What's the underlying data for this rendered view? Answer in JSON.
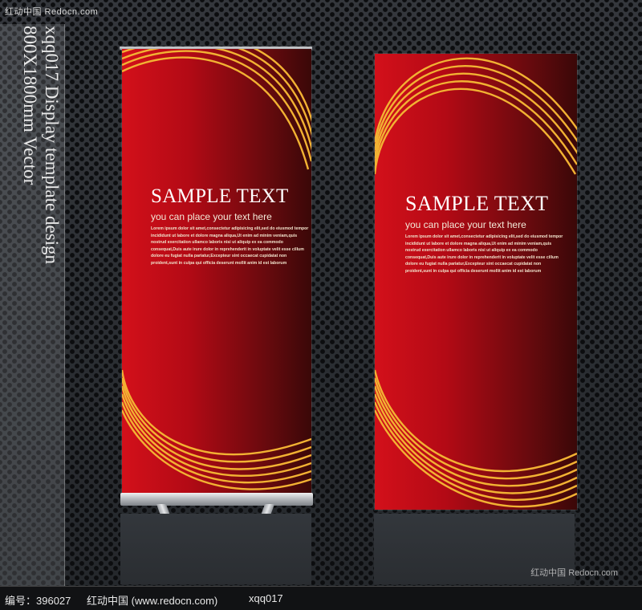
{
  "watermark_top": "红动中国 Redocn.com",
  "watermark_bottom_right": "红动中国 Redocn.com",
  "side_caption": {
    "line1": "xqq017 Display template design",
    "line2": "800X1800mm Vector"
  },
  "banners": [
    {
      "title": "SAMPLE TEXT",
      "subtitle": "you can place your text here",
      "body": [
        "Lorem ipsum dolor sit amet,consectetur adipisicing elit,sed do eiusmod tempor",
        "incididunt ut labore et dolore magna aliqua,Ut enim ad minim veniam,quis",
        "nostrud exercitation ullamco laboris nisi ut aliquip ex ea commodo",
        "consequat,Duis aute irure dolor in reprehenderit in voluptate velit esse cillum",
        "dolore eu fugiat nulla pariatur,Excepteur sint occaecat cupidatat non",
        "proident,sunt in culpa qui officia deserunt mollit anim id est laborum"
      ]
    },
    {
      "title": "SAMPLE TEXT",
      "subtitle": "you can place your text here",
      "body": [
        "Lorem ipsum dolor sit amet,consectetur adipisicing elit,sed do eiusmod tempor",
        "incididunt ut labore et dolore magna aliqua,Ut enim ad minim veniam,quis",
        "nostrud exercitation ullamco laboris nisi ut aliquip ex ea commodo",
        "consequat,Duis aute irure dolor in reprehenderit in voluptate velit esse cillum",
        "dolore eu fugiat nulla pariatur,Excepteur sint occaecat cupidatat non",
        "proident,sunt in culpa qui officia deserunt mollit anim id est laborum"
      ]
    }
  ],
  "footer": {
    "id_label": "编号：396027",
    "site": "红动中国 (www.redocn.com)",
    "code": "xqq017"
  },
  "colors": {
    "banner_red": "#d3101a",
    "banner_dark": "#3a0808",
    "arc_gold": "#f2b233"
  }
}
